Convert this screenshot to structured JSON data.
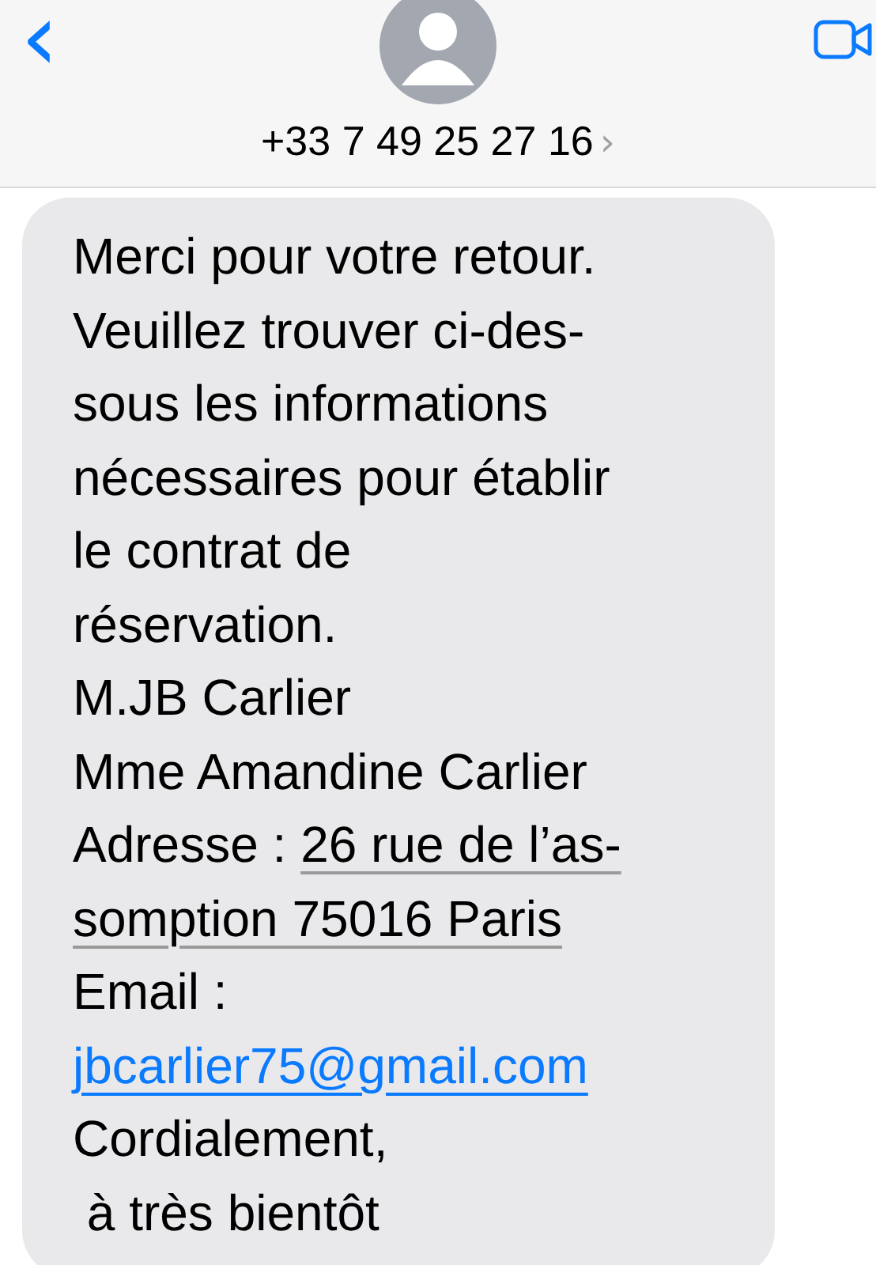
{
  "header": {
    "back": "‹",
    "contact": "+33 7 49 25 27 16",
    "contact_chevron": "›"
  },
  "message": {
    "lines": [
      [
        {
          "kind": "text",
          "text": "Merci pour votre retour."
        }
      ],
      [
        {
          "kind": "text",
          "text": "Veuillez trouver ci-des-"
        }
      ],
      [
        {
          "kind": "text",
          "text": "sous les informations"
        }
      ],
      [
        {
          "kind": "text",
          "text": "nécessaires pour établir"
        }
      ],
      [
        {
          "kind": "text",
          "text": "le contrat de"
        }
      ],
      [
        {
          "kind": "text",
          "text": "réservation."
        }
      ],
      [
        {
          "kind": "text",
          "text": "M.JB Carlier"
        }
      ],
      [
        {
          "kind": "text",
          "text": "Mme Amandine Carlier"
        }
      ],
      [
        {
          "kind": "text",
          "text": "Adresse : "
        },
        {
          "kind": "address",
          "text": "26 rue de l’as-"
        }
      ],
      [
        {
          "kind": "address",
          "text": "somption 75016 Paris"
        }
      ],
      [
        {
          "kind": "text",
          "text": "Email :"
        }
      ],
      [
        {
          "kind": "email",
          "text": "jbcarlier75@gmail.com"
        }
      ],
      [
        {
          "kind": "text",
          "text": "Cordialement,"
        }
      ],
      [
        {
          "kind": "text",
          "text": " à très bientôt"
        }
      ]
    ]
  }
}
